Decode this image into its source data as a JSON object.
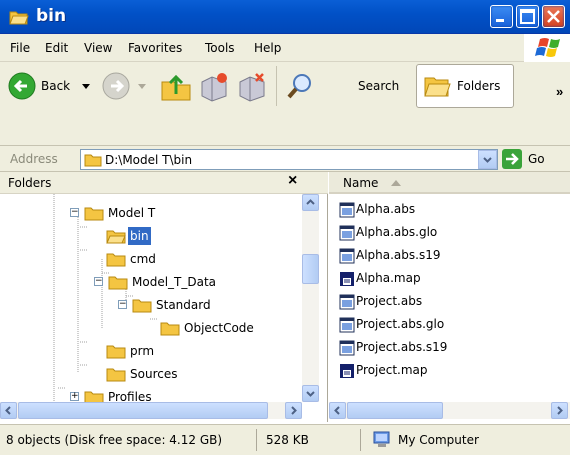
{
  "window": {
    "title": "bin"
  },
  "menu": {
    "items": [
      "File",
      "Edit",
      "View",
      "Favorites",
      "Tools",
      "Help"
    ]
  },
  "toolbar": {
    "back_label": "Back",
    "search_label": "Search",
    "folders_label": "Folders",
    "chevron": "»"
  },
  "address": {
    "label": "Address",
    "value": "D:\\Model T\\bin",
    "go_label": "Go"
  },
  "folders_pane": {
    "title": "Folders",
    "close_glyph": "×",
    "items": [
      {
        "label": "Model T",
        "expander": "−"
      },
      {
        "label": "bin",
        "selected": true
      },
      {
        "label": "cmd"
      },
      {
        "label": "Model_T_Data",
        "expander": "−"
      },
      {
        "label": "Standard",
        "expander": "−"
      },
      {
        "label": "ObjectCode"
      },
      {
        "label": "prm"
      },
      {
        "label": "Sources"
      },
      {
        "label": "Profiles",
        "expander": "+"
      }
    ]
  },
  "files_pane": {
    "column_name": "Name",
    "items": [
      {
        "name": "Alpha.abs",
        "icon": "abs-file-icon"
      },
      {
        "name": "Alpha.abs.glo",
        "icon": "abs-file-icon"
      },
      {
        "name": "Alpha.abs.s19",
        "icon": "abs-file-icon"
      },
      {
        "name": "Alpha.map",
        "icon": "map-file-icon"
      },
      {
        "name": "Project.abs",
        "icon": "abs-file-icon"
      },
      {
        "name": "Project.abs.glo",
        "icon": "abs-file-icon"
      },
      {
        "name": "Project.abs.s19",
        "icon": "abs-file-icon"
      },
      {
        "name": "Project.map",
        "icon": "map-file-icon"
      }
    ]
  },
  "status": {
    "objects": "8 objects (Disk free space: 4.12 GB)",
    "size": "528 KB",
    "location": "My Computer"
  },
  "colors": {
    "title_blue": "#0151c7",
    "selection": "#316ac5",
    "chrome": "#efeede"
  }
}
